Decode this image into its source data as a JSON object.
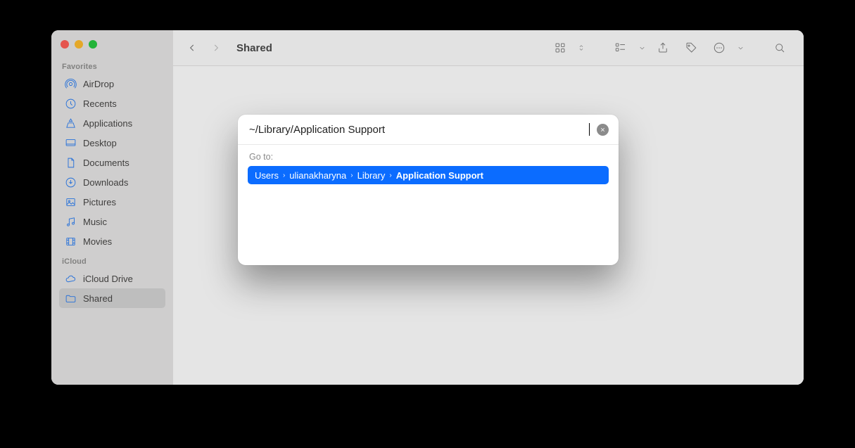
{
  "window_title": "Shared",
  "sidebar": {
    "section_favorites": "Favorites",
    "section_icloud": "iCloud",
    "favorites": [
      {
        "id": "airdrop",
        "label": "AirDrop"
      },
      {
        "id": "recents",
        "label": "Recents"
      },
      {
        "id": "applications",
        "label": "Applications"
      },
      {
        "id": "desktop",
        "label": "Desktop"
      },
      {
        "id": "documents",
        "label": "Documents"
      },
      {
        "id": "downloads",
        "label": "Downloads"
      },
      {
        "id": "pictures",
        "label": "Pictures"
      },
      {
        "id": "music",
        "label": "Music"
      },
      {
        "id": "movies",
        "label": "Movies"
      }
    ],
    "icloud": [
      {
        "id": "iclouddrive",
        "label": "iCloud Drive"
      },
      {
        "id": "shared",
        "label": "Shared"
      }
    ],
    "selected": "shared"
  },
  "goto_sheet": {
    "input_value": "~/Library/Application Support",
    "label": "Go to:",
    "breadcrumb": [
      "Users",
      "ulianakharyna",
      "Library",
      "Application Support"
    ]
  }
}
